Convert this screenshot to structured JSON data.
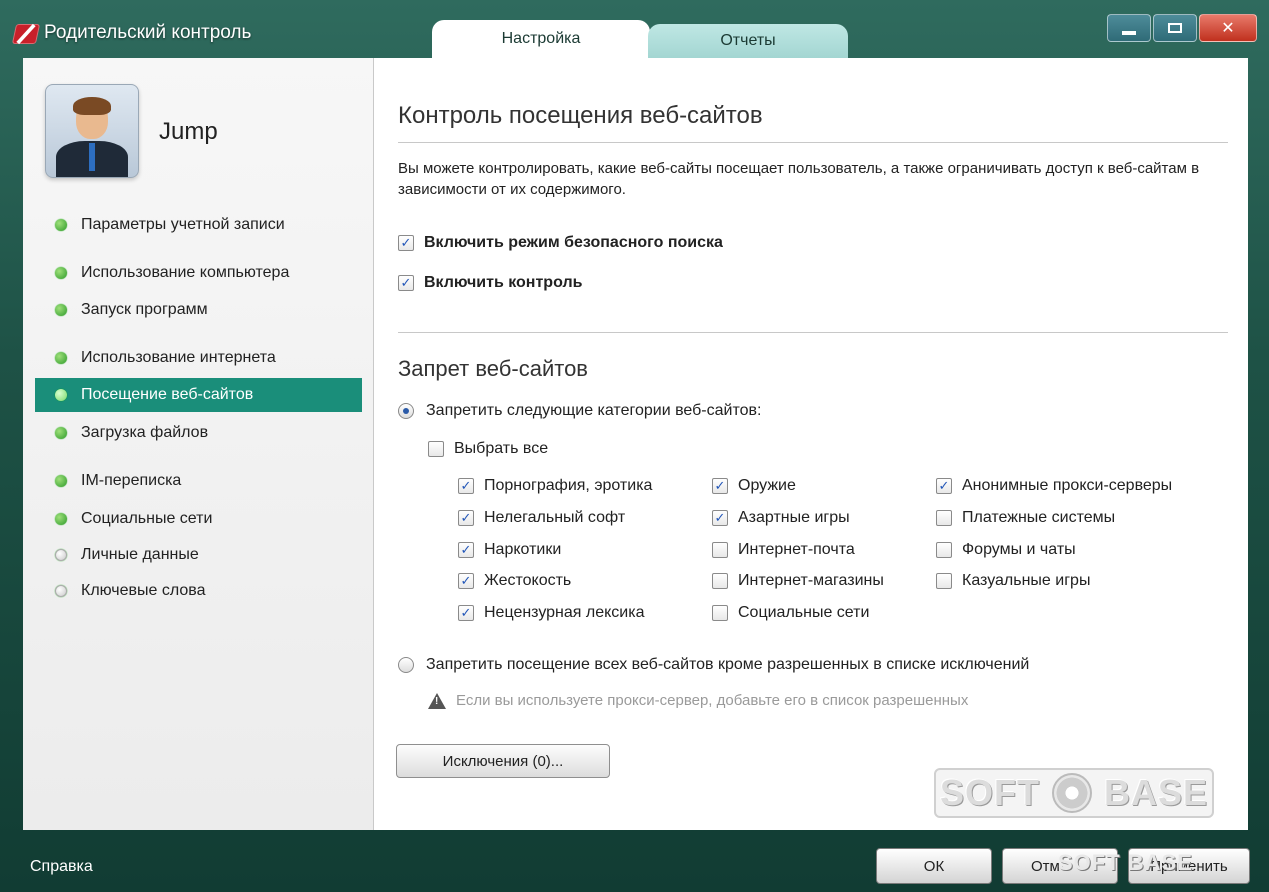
{
  "window": {
    "title": "Родительский контроль",
    "tabs": [
      {
        "label": "Настройка",
        "active": true
      },
      {
        "label": "Отчеты",
        "active": false
      }
    ]
  },
  "user": {
    "name": "Jump"
  },
  "sidebar": {
    "items": [
      {
        "label": "Параметры учетной записи",
        "enabled": true
      },
      {
        "label": "Использование компьютера",
        "enabled": true
      },
      {
        "label": "Запуск программ",
        "enabled": true
      },
      {
        "label": "Использование интернета",
        "enabled": true
      },
      {
        "label": "Посещение веб-сайтов",
        "enabled": true,
        "active": true
      },
      {
        "label": "Загрузка файлов",
        "enabled": true
      },
      {
        "label": "IM-переписка",
        "enabled": true
      },
      {
        "label": "Социальные сети",
        "enabled": true
      },
      {
        "label": "Личные данные",
        "enabled": false
      },
      {
        "label": "Ключевые слова",
        "enabled": false
      }
    ]
  },
  "main": {
    "title": "Контроль посещения веб-сайтов",
    "description": "Вы можете контролировать, какие веб-сайты посещает пользователь, а также ограничивать доступ к веб-сайтам в зависимости от их содержимого.",
    "safe_search": {
      "label": "Включить режим безопасного поиска",
      "checked": true
    },
    "enable_control": {
      "label": "Включить контроль",
      "checked": true
    },
    "block_section_title": "Запрет веб-сайтов",
    "radio_categories": {
      "label": "Запретить следующие категории веб-сайтов:",
      "selected": true
    },
    "select_all": {
      "label": "Выбрать все",
      "checked": false
    },
    "categories": [
      [
        {
          "label": "Порнография, эротика",
          "checked": true
        },
        {
          "label": "Нелегальный софт",
          "checked": true
        },
        {
          "label": "Наркотики",
          "checked": true
        },
        {
          "label": "Жестокость",
          "checked": true
        },
        {
          "label": "Нецензурная лексика",
          "checked": true
        }
      ],
      [
        {
          "label": "Оружие",
          "checked": true
        },
        {
          "label": "Азартные игры",
          "checked": true
        },
        {
          "label": "Интернет-почта",
          "checked": false
        },
        {
          "label": "Интернет-магазины",
          "checked": false
        },
        {
          "label": "Социальные сети",
          "checked": false
        }
      ],
      [
        {
          "label": "Анонимные прокси-серверы",
          "checked": true
        },
        {
          "label": "Платежные системы",
          "checked": false
        },
        {
          "label": "Форумы и чаты",
          "checked": false
        },
        {
          "label": "Казуальные игры",
          "checked": false
        }
      ]
    ],
    "radio_all_except": {
      "label": "Запретить посещение всех веб-сайтов кроме разрешенных в списке исключений",
      "selected": false
    },
    "warning": "Если вы используете прокси-сервер, добавьте его в список разрешенных",
    "exceptions_button": "Исключения (0)...",
    "watermark": {
      "left": "SOFT",
      "right": "BASE"
    }
  },
  "footer": {
    "help": "Справка",
    "ok": "ОК",
    "cancel": "Отм",
    "apply": "Применить",
    "watermark": "SOFT  BASE"
  }
}
